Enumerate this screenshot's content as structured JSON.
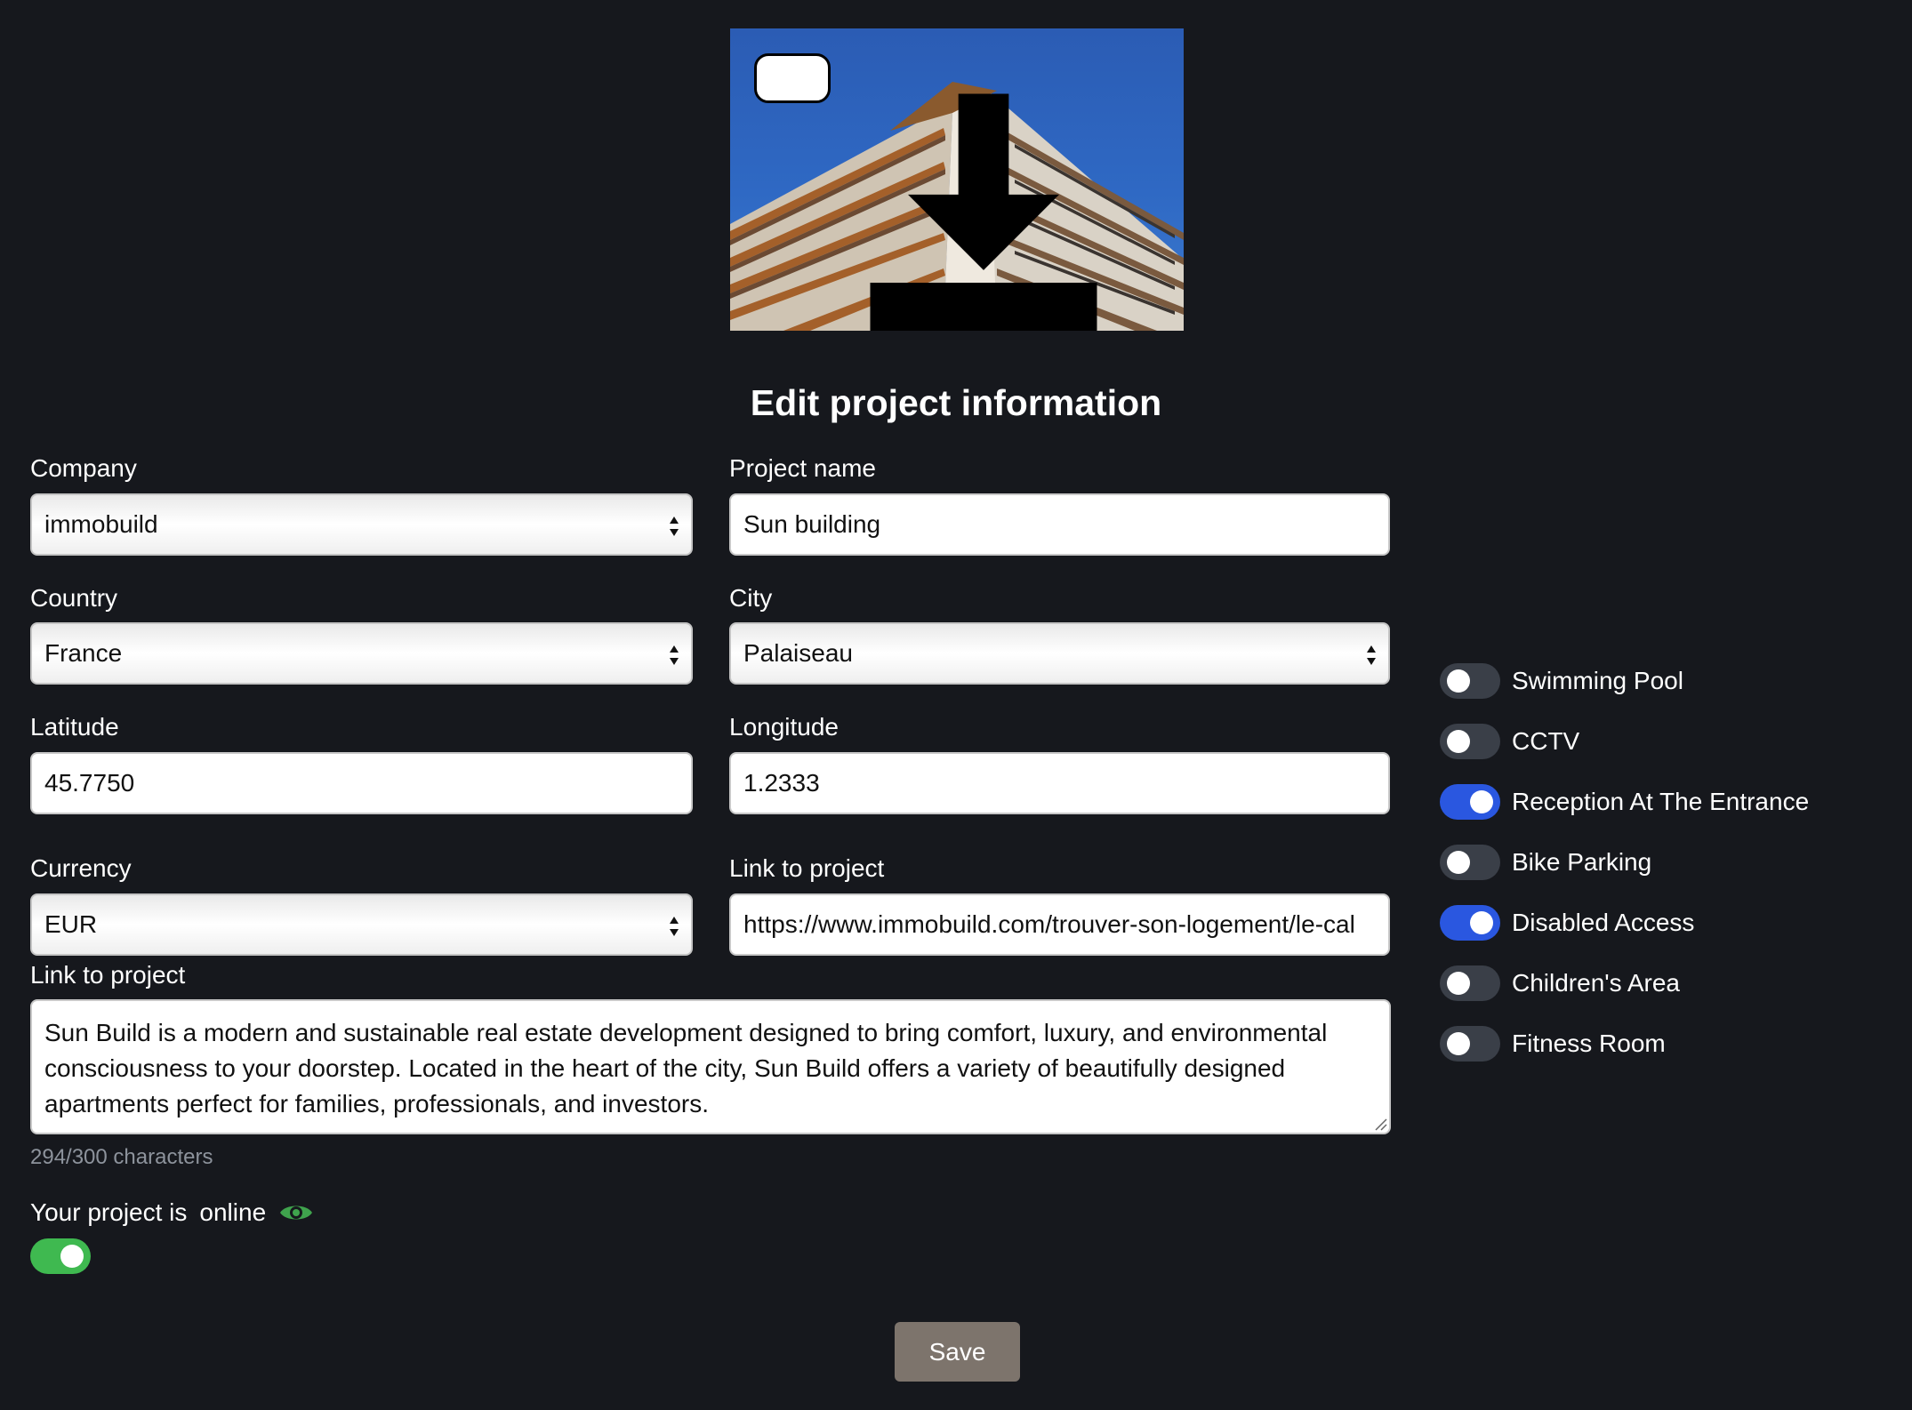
{
  "title": "Edit project information",
  "image": {
    "download_icon": "download-icon"
  },
  "form": {
    "company": {
      "label": "Company",
      "value": "immobuild"
    },
    "project_name": {
      "label": "Project name",
      "value": "Sun building"
    },
    "country": {
      "label": "Country",
      "value": "France"
    },
    "city": {
      "label": "City",
      "value": "Palaiseau"
    },
    "latitude": {
      "label": "Latitude",
      "value": "45.7750"
    },
    "longitude": {
      "label": "Longitude",
      "value": "1.2333"
    },
    "currency": {
      "label": "Currency",
      "value": "EUR"
    },
    "link": {
      "label": "Link to project",
      "value": "https://www.immobuild.com/trouver-son-logement/le-cal"
    },
    "description": {
      "label": "Link to project",
      "value": "Sun Build is a modern and sustainable real estate development designed to bring comfort, luxury, and environmental consciousness to your doorstep. Located in the heart of the city, Sun Build offers a variety of beautifully designed apartments perfect for families, professionals, and investors.",
      "counter": "294/300 characters"
    }
  },
  "status": {
    "prefix": "Your project is",
    "state": "online",
    "icon": "eye-icon",
    "enabled": true
  },
  "amenities": [
    {
      "label": "Swimming Pool",
      "enabled": false
    },
    {
      "label": "CCTV",
      "enabled": false
    },
    {
      "label": "Reception At The Entrance",
      "enabled": true
    },
    {
      "label": "Bike Parking",
      "enabled": false
    },
    {
      "label": "Disabled Access",
      "enabled": true
    },
    {
      "label": "Children's Area",
      "enabled": false
    },
    {
      "label": "Fitness Room",
      "enabled": false
    }
  ],
  "save_label": "Save",
  "colors": {
    "background": "#16181d",
    "toggle_on_blue": "#2a57e0",
    "toggle_on_green": "#3fb950",
    "toggle_off": "#3a3f48",
    "save_button": "#7d746c"
  }
}
